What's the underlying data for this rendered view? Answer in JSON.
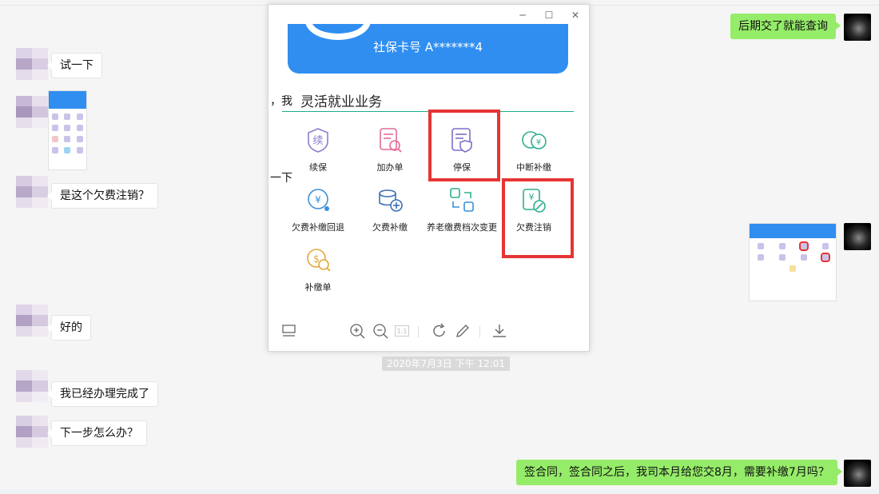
{
  "chat": {
    "messages": [
      {
        "side": "right",
        "text": "后期交了就能查询"
      },
      {
        "side": "left",
        "text": "试一下"
      },
      {
        "side": "left",
        "text": "是这个欠费注销？"
      },
      {
        "side": "left",
        "text": "好的"
      },
      {
        "side": "left",
        "text": "我已经办理完成了"
      },
      {
        "side": "left",
        "text": "下一步怎么办？"
      },
      {
        "side": "right",
        "text": "签合同，签合同之后，我司本月给您交8月，需要补缴7月吗？"
      }
    ],
    "timestamp": "2020年7月3日 下午 12:01",
    "edge_text_1": "，我",
    "edge_text_2": "一下"
  },
  "viewer": {
    "window_controls": {
      "minimize": "─",
      "maximize": "☐",
      "close": "✕"
    },
    "card_number": "社保卡号 A*******4",
    "section_title": "灵活就业业务",
    "items": [
      {
        "label": "续保",
        "icon": "renew-icon"
      },
      {
        "label": "加办单",
        "icon": "add-form-icon"
      },
      {
        "label": "停保",
        "icon": "stop-insurance-icon"
      },
      {
        "label": "中断补缴",
        "icon": "interrupt-pay-icon"
      },
      {
        "label": "欠费补缴回退",
        "icon": "arrears-rollback-icon"
      },
      {
        "label": "欠费补缴",
        "icon": "arrears-pay-icon"
      },
      {
        "label": "养老缴费档次变更",
        "icon": "pension-level-icon"
      },
      {
        "label": "欠费注销",
        "icon": "arrears-cancel-icon"
      },
      {
        "label": "补缴单",
        "icon": "payment-form-icon"
      }
    ],
    "highlighted": [
      "停保",
      "欠费注销"
    ],
    "toolbar": [
      "thumbnail-icon",
      "zoom-in-icon",
      "zoom-out-icon",
      "actual-size-icon",
      "rotate-icon",
      "edit-icon",
      "download-icon"
    ],
    "actual_size_label": "1:1"
  },
  "colors": {
    "accent_blue": "#2f8ef0",
    "highlight_red": "#e63434",
    "bubble_green": "#95ec69"
  }
}
